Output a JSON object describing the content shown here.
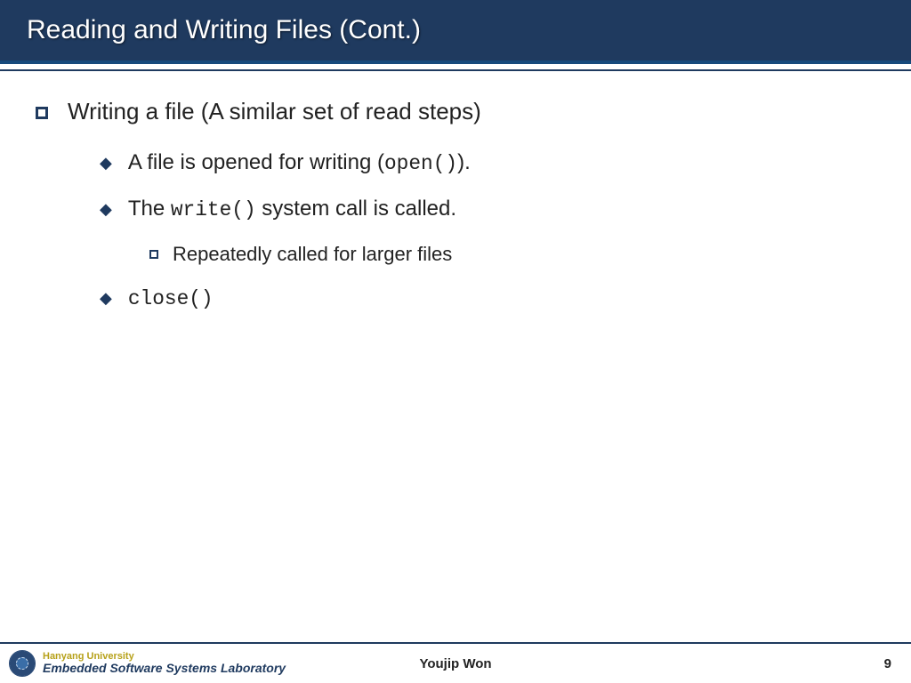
{
  "title": "Reading and Writing Files (Cont.)",
  "bullets": {
    "lvl1": "Writing a file (A similar set of read steps)",
    "lvl2": {
      "a_pre": "A file is opened for writing (",
      "a_code": "open()",
      "a_post": ").",
      "b_pre": "The ",
      "b_code": "write()",
      "b_post": " system call is called.",
      "c_code": "close()"
    },
    "lvl3": {
      "a": "Repeatedly called for larger files"
    }
  },
  "footer": {
    "org_line1": "Hanyang University",
    "org_line2": "Embedded Software Systems Laboratory",
    "author": "Youjip Won",
    "page": "9"
  }
}
